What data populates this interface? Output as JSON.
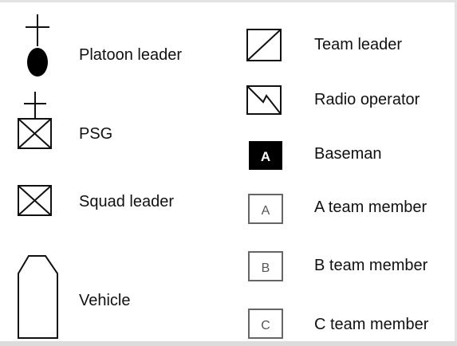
{
  "legend": {
    "left_column": [
      {
        "icon": "platoon-leader-icon",
        "label": "Platoon leader"
      },
      {
        "icon": "psg-icon",
        "label": "PSG"
      },
      {
        "icon": "squad-leader-icon",
        "label": "Squad leader"
      },
      {
        "icon": "vehicle-icon",
        "label": "Vehicle"
      }
    ],
    "right_column": [
      {
        "icon": "team-leader-icon",
        "label": "Team leader"
      },
      {
        "icon": "radio-operator-icon",
        "label": "Radio operator"
      },
      {
        "icon": "baseman-icon",
        "label": "Baseman",
        "letter": "A"
      },
      {
        "icon": "a-team-member-icon",
        "label": "A team member",
        "letter": "A"
      },
      {
        "icon": "b-team-member-icon",
        "label": "B team member",
        "letter": "B"
      },
      {
        "icon": "c-team-member-icon",
        "label": "C team member",
        "letter": "C"
      }
    ]
  },
  "colors": {
    "symbol_stroke": "#111111",
    "letter_box_stroke": "#666666",
    "letter_text": "#555555",
    "baseman_fill": "#000000",
    "baseman_text": "#ffffff"
  }
}
